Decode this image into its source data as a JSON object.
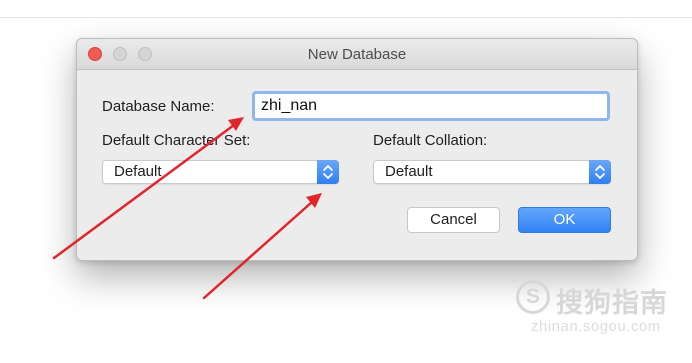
{
  "dialog": {
    "title": "New Database",
    "database_name_label": "Database Name:",
    "database_name_value": "zhi_nan",
    "charset_label": "Default Character Set:",
    "charset_value": "Default",
    "collation_label": "Default Collation:",
    "collation_value": "Default",
    "cancel_label": "Cancel",
    "ok_label": "OK"
  },
  "watermark": {
    "logo": "S",
    "site_name": "搜狗指南",
    "url": "zhinan.sogou.com"
  },
  "colors": {
    "accent": "#2f83f5",
    "focus_ring": "#8fb6f0",
    "close_button": "#f15b56",
    "annotation_arrow": "#e0262b"
  },
  "icons": {
    "stepper": "up-down-chevron-icon",
    "window_controls": [
      "close-icon",
      "minimize-icon",
      "zoom-icon"
    ]
  }
}
